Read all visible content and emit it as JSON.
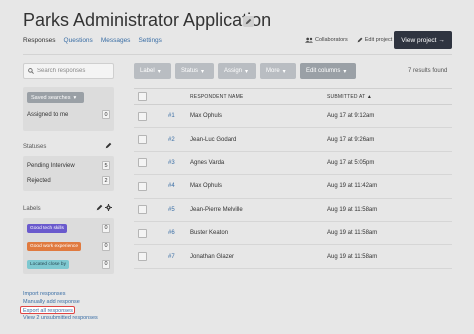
{
  "app": {
    "title": "Parks Administrator Application"
  },
  "nav": {
    "tabs": [
      "Responses",
      "Questions",
      "Messages",
      "Settings"
    ]
  },
  "header_actions": {
    "collaborators": "Collaborators",
    "edit_project": "Edit project",
    "view_project": "View project →"
  },
  "sidebar": {
    "search_placeholder": "Search responses",
    "saved_searches": "Saved searches",
    "assigned_label": "Assigned to me",
    "assigned_count": "0",
    "statuses_heading": "Statuses",
    "statuses": [
      {
        "label": "Pending Interview",
        "count": "5"
      },
      {
        "label": "Rejected",
        "count": "2"
      }
    ],
    "labels_heading": "Labels",
    "labels": [
      {
        "label": "Good tech skills",
        "count": "0",
        "color": "#6a5acd"
      },
      {
        "label": "Good work experience",
        "count": "0",
        "color": "#e07a3f"
      },
      {
        "label": "Located close by",
        "count": "0",
        "color": "#7ec8d0"
      }
    ],
    "links": [
      "Import responses",
      "Manually add response",
      "Export all responses",
      "View 2 unsubmitted responses"
    ]
  },
  "toolbar": {
    "label": "Label",
    "status": "Status",
    "assign": "Assign",
    "more": "More",
    "edit_columns": "Edit columns",
    "results": "7 results found"
  },
  "table": {
    "headers": {
      "respondent": "RESPONDENT NAME",
      "submitted": "SUBMITTED AT ▲"
    },
    "rows": [
      {
        "num": "#1",
        "name": "Max Ophuls",
        "date": "Aug 17 at 9:12am"
      },
      {
        "num": "#2",
        "name": "Jean-Luc Godard",
        "date": "Aug 17 at 9:26am"
      },
      {
        "num": "#3",
        "name": "Agnes Varda",
        "date": "Aug 17 at 5:05pm"
      },
      {
        "num": "#4",
        "name": "Max Ophuls",
        "date": "Aug 19 at 11:42am"
      },
      {
        "num": "#5",
        "name": "Jean-Pierre Melville",
        "date": "Aug 19 at 11:58am"
      },
      {
        "num": "#6",
        "name": "Buster Keaton",
        "date": "Aug 19 at 11:58am"
      },
      {
        "num": "#7",
        "name": "Jonathan Glazer",
        "date": "Aug 19 at 11:58am"
      }
    ]
  }
}
